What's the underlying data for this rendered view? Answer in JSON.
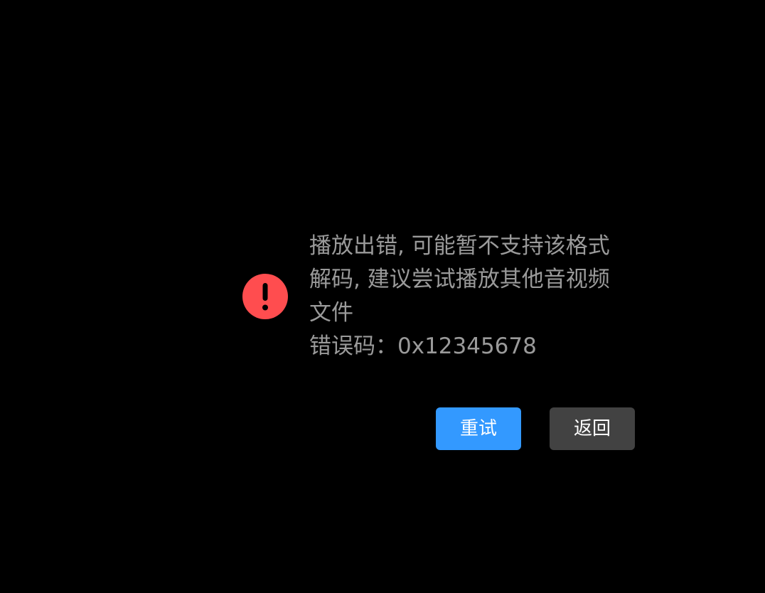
{
  "dialog": {
    "icon": "exclamation-circle-icon",
    "icon_color": "#ff4d4f",
    "message_lines": [
      "播放出错, 可能暂不支持该格式",
      "解码, 建议尝试播放其他音视频",
      "文件"
    ],
    "error_code_line": "错误码：0x12345678",
    "text_color": "#9a9a9a"
  },
  "buttons": {
    "retry_label": "重试",
    "retry_color": "#3399ff",
    "back_label": "返回",
    "back_color": "#424242"
  }
}
